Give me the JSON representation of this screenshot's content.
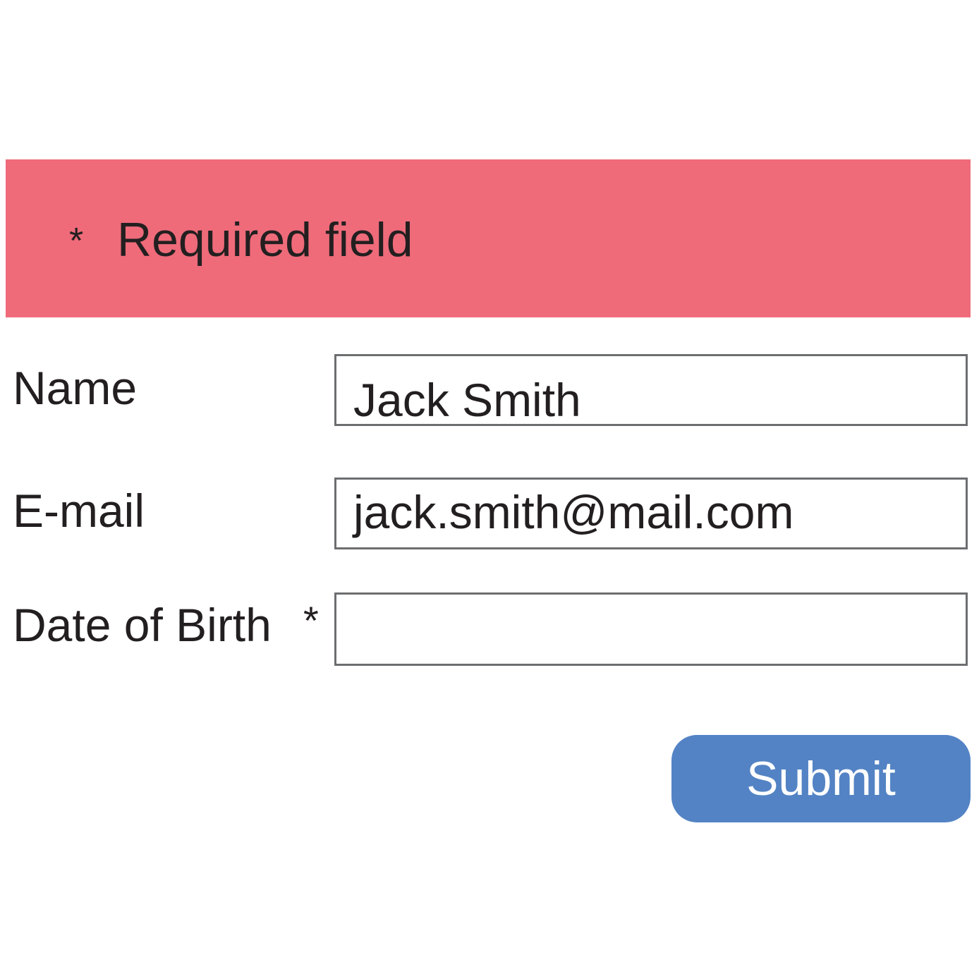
{
  "banner": {
    "marker": "*",
    "text": "Required field",
    "color": "#ef6b7a"
  },
  "form": {
    "fields": [
      {
        "label": "Name",
        "value": "Jack Smith",
        "required": false
      },
      {
        "label": "E-mail",
        "value": "jack.smith@mail.com",
        "required": false
      },
      {
        "label": "Date of Birth",
        "value": "",
        "required": true,
        "required_marker": "*"
      }
    ],
    "submit_label": "Submit",
    "submit_color": "#5383c4"
  }
}
